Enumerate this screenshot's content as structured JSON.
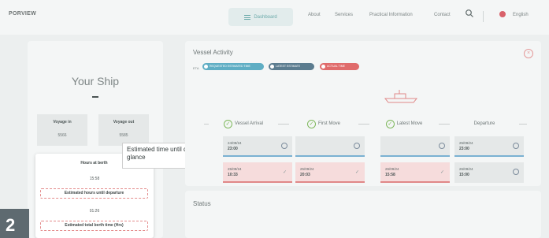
{
  "header": {
    "logo": "PORVIEW",
    "nav": {
      "dashboard": "Dashboard",
      "about": "About",
      "services": "Services",
      "practical": "Practical Information",
      "contact": "Contact"
    },
    "language": "English"
  },
  "left_card": {
    "title": "Your Ship",
    "voyage_in_label": "Voyage in",
    "voyage_out_label": "Voyage out",
    "voyage_in_value": "5566",
    "voyage_out_value": "5585",
    "hours_at_berth_label": "Hours at berth",
    "hours_at_berth_value": "15:58",
    "est_hours_departure_label": "Estimated hours until departure",
    "est_hours_departure_value": "01:26",
    "est_total_berth_label": "Estimated total berth time (Hrs)"
  },
  "tooltip": {
    "text": "Estimated time until departure at a glance"
  },
  "step": "2",
  "vessel_activity": {
    "title": "Vessel Activity",
    "legend_lead": "ETA",
    "legend": [
      {
        "label": "REQUESTED ESTIMATED TIME",
        "color": "#5faec4"
      },
      {
        "label": "LATEST ESTIMATE",
        "color": "#5b7c8f"
      },
      {
        "label": "ACTUAL TIME",
        "color": "#e06b6b"
      }
    ],
    "stages": [
      "Vessel Arrival",
      "First Move",
      "Latest Move",
      "Departure"
    ],
    "estimates": [
      {
        "date": "24/09/24",
        "time": "23:00"
      },
      {
        "date": "",
        "time": ""
      },
      {
        "date": "",
        "time": ""
      },
      {
        "date": "25/09/24",
        "time": "23:00"
      }
    ],
    "actuals": [
      {
        "date": "25/09/24",
        "time": "10:33"
      },
      {
        "date": "25/09/24",
        "time": "20:03"
      },
      {
        "date": "26/09/24",
        "time": "15:58"
      },
      {
        "date": "26/09/24",
        "time": "15:00"
      }
    ]
  },
  "status": {
    "title": "Status"
  }
}
